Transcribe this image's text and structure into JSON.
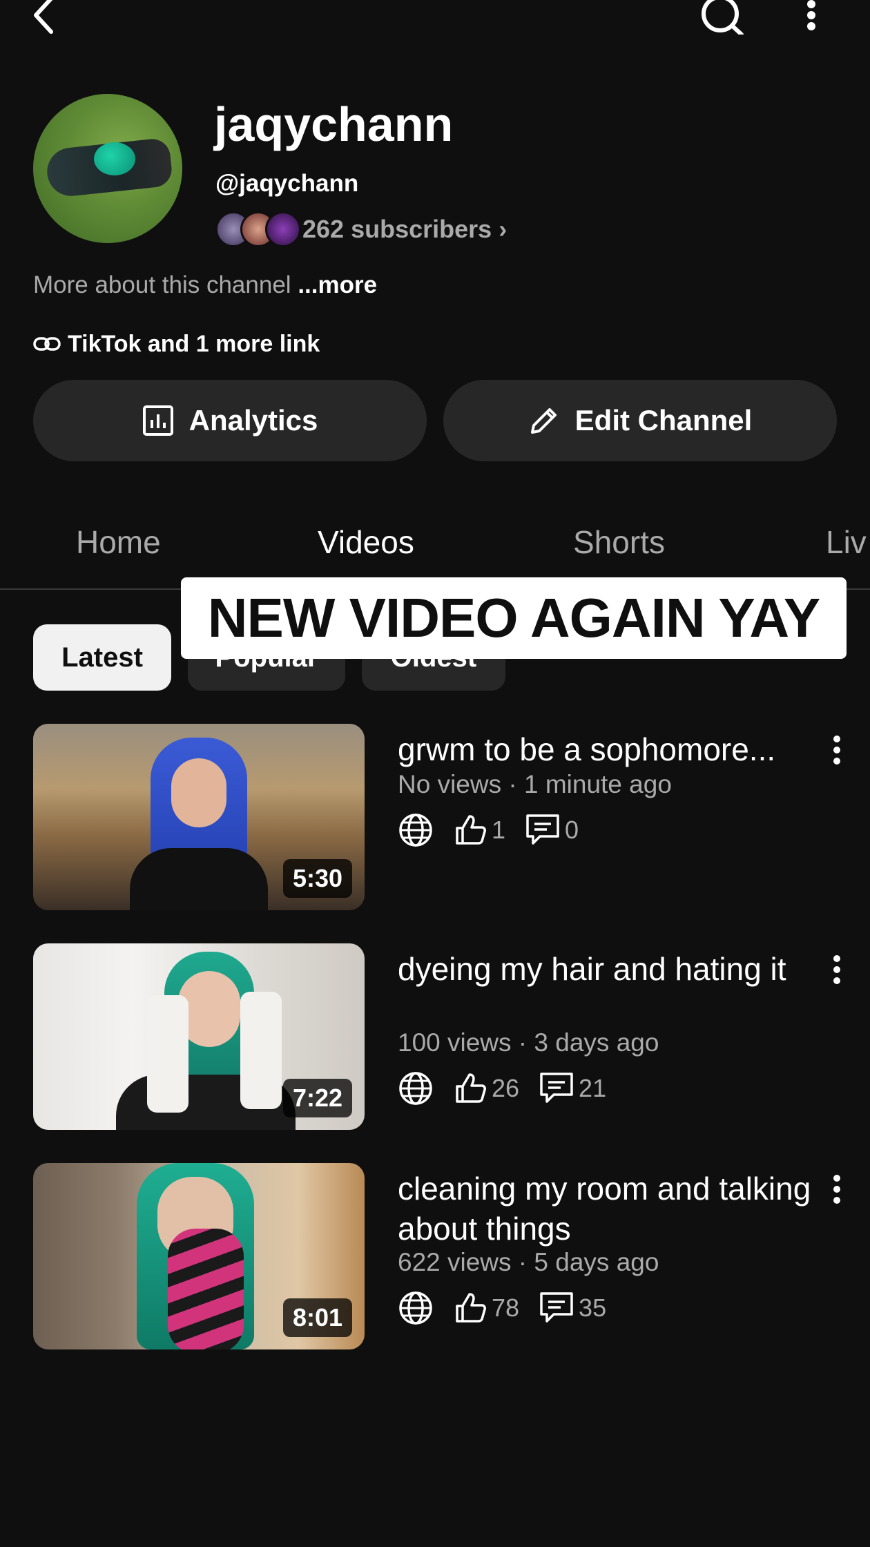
{
  "channel": {
    "name": "jaqychann",
    "handle": "@jaqychann",
    "subscribers": "262 subscribers",
    "about_text": "More about this channel",
    "about_more": "...more",
    "links_text": "TikTok and 1 more link"
  },
  "actions": {
    "analytics_label": "Analytics",
    "edit_label": "Edit Channel"
  },
  "tabs": [
    "Home",
    "Videos",
    "Shorts",
    "Liv"
  ],
  "active_tab": "Videos",
  "filters": [
    "Latest",
    "Popular",
    "Oldest"
  ],
  "selected_filter": "Latest",
  "overlay_caption": "NEW VIDEO AGAIN YAY",
  "videos": [
    {
      "title": "grwm to be a sophomore...",
      "meta": "No views · 1 minute ago",
      "likes": "1",
      "comments": "0",
      "duration": "5:30"
    },
    {
      "title": "dyeing my hair and hating it",
      "meta": "100 views · 3 days ago",
      "likes": "26",
      "comments": "21",
      "duration": "7:22"
    },
    {
      "title": "cleaning my room and talking about things",
      "meta": "622 views · 5 days ago",
      "likes": "78",
      "comments": "35",
      "duration": "8:01"
    }
  ],
  "icons": {
    "back": "chevron-left-icon",
    "search": "search-icon",
    "more": "vertical-dots-icon",
    "link": "link-icon",
    "analytics": "bar-chart-icon",
    "edit": "pencil-icon",
    "visibility": "globe-icon",
    "likes": "thumbs-up-icon",
    "comments": "comment-icon"
  },
  "colors": {
    "background": "#0f0f0f",
    "secondary_text": "#aaaaaa",
    "button_bg": "#272727",
    "chip_selected_bg": "#f1f1f1"
  }
}
